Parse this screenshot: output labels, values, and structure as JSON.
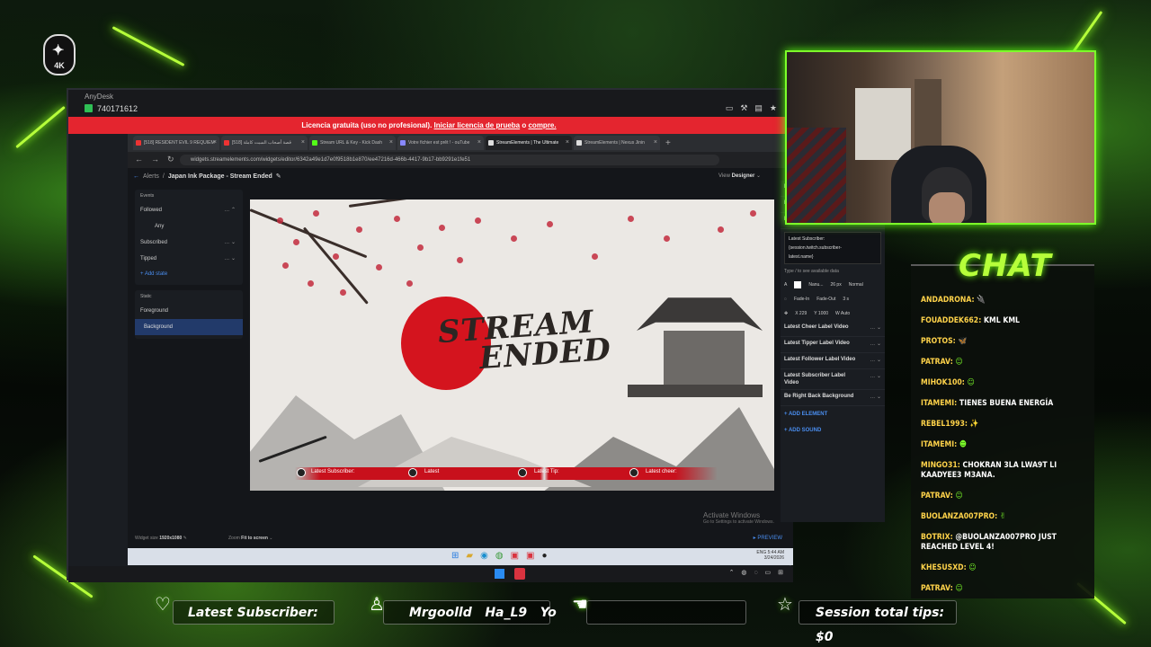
{
  "logo": {
    "text": "4K"
  },
  "remote_window": {
    "title": "AnyDesk",
    "session_id": "740171612",
    "licence_notice": {
      "prefix": "Licencia gratuita (uso no profesional).",
      "link1": "Iniciar licencia de prueba",
      "middle": "o",
      "link2": "compre."
    }
  },
  "browser": {
    "tabs": [
      {
        "label": "[518] RESIDENT EVIL 9 REQUIEM",
        "color": "#e33"
      },
      {
        "label": "[518] قصة أصحاب السبت كاملة",
        "color": "#e33"
      },
      {
        "label": "Stream URL & Key - Kick Dash",
        "color": "#53fc18"
      },
      {
        "label": "Votre fichier est prêt ! - ouTube",
        "color": "#88f"
      },
      {
        "label": "StreamElements | The Ultimate",
        "color": "#ddd",
        "active": true
      },
      {
        "label": "StreamElements | Nexus Jinin",
        "color": "#ddd"
      }
    ],
    "new_tab": "+",
    "url": "widgets.streamelements.com/widgets/editor/6342a49e1d7e0f9518b1e870/ee47216d-466b-4417-9b17-bb9291e1fe51"
  },
  "editor": {
    "breadcrumb": {
      "root": "Alerts",
      "sep": "/",
      "current": "Japan Ink Package - Stream Ended"
    },
    "view": {
      "label": "View",
      "value": "Designer"
    },
    "events": {
      "heading": "Events",
      "items": [
        {
          "label": "Followed",
          "ctl": "… ⌃"
        },
        {
          "label": "Any",
          "ctl": ""
        },
        {
          "label": "Subscribed",
          "ctl": "… ⌄"
        },
        {
          "label": "Tipped",
          "ctl": "… ⌄"
        }
      ],
      "add": "+ Add state"
    },
    "statics": {
      "heading": "Static",
      "items": [
        "Foreground",
        "Background"
      ]
    },
    "canvas": {
      "title_line1": "STREAM",
      "title_line2": "ENDED",
      "strip_labels": [
        "Latest Subscriber:",
        "Latest",
        "Latest Tip:",
        "Latest cheer:"
      ]
    },
    "settings": {
      "rows_top": [
        {
          "label": "Latest Tipper Label Text",
          "ctl": "… ⌄"
        },
        {
          "label": "Latest Follower Label Text",
          "ctl": "… ⌄"
        },
        {
          "label": "Latest Subscriber Label Text",
          "ctl": "… ⌃"
        }
      ],
      "sub_text_line1": "Latest Subscriber:",
      "sub_text_line2": "{session.twitch.subscriber-",
      "sub_text_line3": "latest.name}",
      "hint": "Type / to see available data",
      "font": {
        "name": "Nanu...",
        "size": "26",
        "unit": "px",
        "weight": "Normal"
      },
      "anim": {
        "in": "Fade-In",
        "out": "Fade-Out",
        "dur": "3 s"
      },
      "pos": {
        "x": "X 229",
        "y": "Y 1000",
        "w": "W Auto"
      },
      "rows_bottom": [
        {
          "label": "Latest Cheer Label Video",
          "ctl": "… ⌄"
        },
        {
          "label": "Latest Tipper Label Video",
          "ctl": "… ⌄"
        },
        {
          "label": "Latest Follower Label Video",
          "ctl": "… ⌄"
        },
        {
          "label": "Latest Subscriber Label Video",
          "ctl": "… ⌄"
        },
        {
          "label": "Be Right Back Background",
          "ctl": "… ⌄"
        }
      ],
      "add_element": "+ ADD ELEMENT",
      "add_sound": "+ ADD SOUND"
    },
    "widget_size": {
      "label": "Widget size",
      "value": "1920x1080"
    },
    "zoom": {
      "label": "Zoom",
      "value": "Fit to screen"
    },
    "preview": "▸ PREVIEW"
  },
  "activate_windows": {
    "title": "Activate Windows",
    "sub": "Go to Settings to activate Windows."
  },
  "remote_taskbar": {
    "time": "5:44 AM",
    "date": "3/24/2026",
    "lang": "ENG"
  },
  "chat": {
    "title": "CHAT",
    "messages": [
      {
        "user": "ANDADRONA:",
        "text": "",
        "emoji": "🔌"
      },
      {
        "user": "FOUADDEK662:",
        "text": "KML KML",
        "emoji": ""
      },
      {
        "user": "PROTOS:",
        "text": "",
        "emoji": "🦋"
      },
      {
        "user": "PATRAV:",
        "text": "",
        "emoji": "☺"
      },
      {
        "user": "MIHOK100:",
        "text": "",
        "emoji": "☺"
      },
      {
        "user": "ITAMEMI:",
        "text": "TIENES BUENA ENERGÍA",
        "emoji": ""
      },
      {
        "user": "REBEL1993:",
        "text": "",
        "emoji": "✨"
      },
      {
        "user": "ITAMEMI:",
        "text": "",
        "emoji": "☻"
      },
      {
        "user": "MINGO31:",
        "text": "CHOKRAN 3LA LWA9T LI KAADYEE3 M3ANA.",
        "emoji": ""
      },
      {
        "user": "PATRAV:",
        "text": "",
        "emoji": "☺"
      },
      {
        "user": "BUOLANZA007PRO:",
        "text": "",
        "emoji": "✌"
      },
      {
        "user": "BOTRIX:",
        "text": "@BUOLANZA007PRO JUST REACHED LEVEL 4!",
        "emoji": ""
      },
      {
        "user": "KHESUSXD:",
        "text": "",
        "emoji": "☺"
      },
      {
        "user": "PATRAV:",
        "text": "",
        "emoji": "☺"
      }
    ]
  },
  "overlay_bar": {
    "latest_subscriber": "Latest Subscriber:",
    "follower_names": "Mrgoolld   Ha_L9   Yo",
    "session_tips": "Session total tips: $0"
  }
}
